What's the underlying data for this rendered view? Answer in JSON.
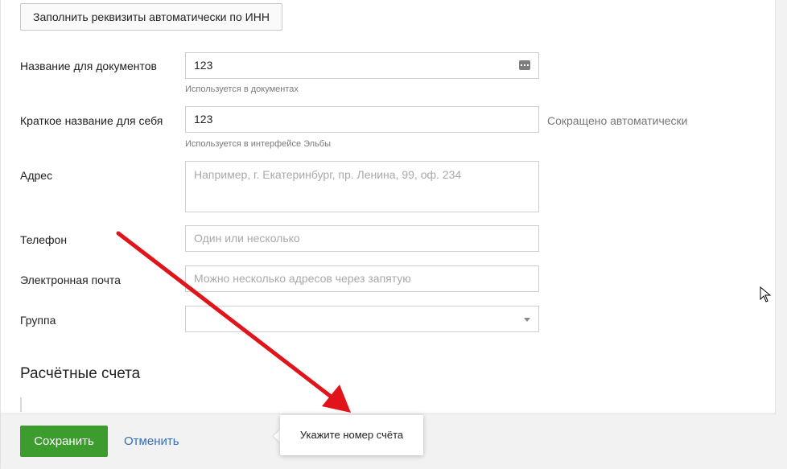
{
  "top_button": "Заполнить реквизиты автоматически по ИНН",
  "fields": {
    "doc_name": {
      "label": "Название для документов",
      "value": "123",
      "hint": "Используется в документах",
      "icon": "dots-icon"
    },
    "short_name": {
      "label": "Краткое название для себя",
      "value": "123",
      "hint": "Используется в интерфейсе Эльбы",
      "note": "Сокращено автоматически"
    },
    "address": {
      "label": "Адрес",
      "placeholder": "Например, г. Екатеринбург, пр. Ленина, 99, оф. 234"
    },
    "phone": {
      "label": "Телефон",
      "placeholder": "Один или несколько"
    },
    "email": {
      "label": "Электронная почта",
      "placeholder": "Можно несколько адресов через запятую"
    },
    "group": {
      "label": "Группа",
      "value": "",
      "icon": "chevron-down-icon"
    }
  },
  "section": {
    "title": "Расчётные счета"
  },
  "footer": {
    "save": "Сохранить",
    "cancel": "Отменить"
  },
  "tooltip": {
    "text": "Укажите номер счёта"
  },
  "colors": {
    "save_button": "#3d9c2e",
    "link": "#2f6fbf",
    "annotation_arrow": "#e0141a"
  }
}
